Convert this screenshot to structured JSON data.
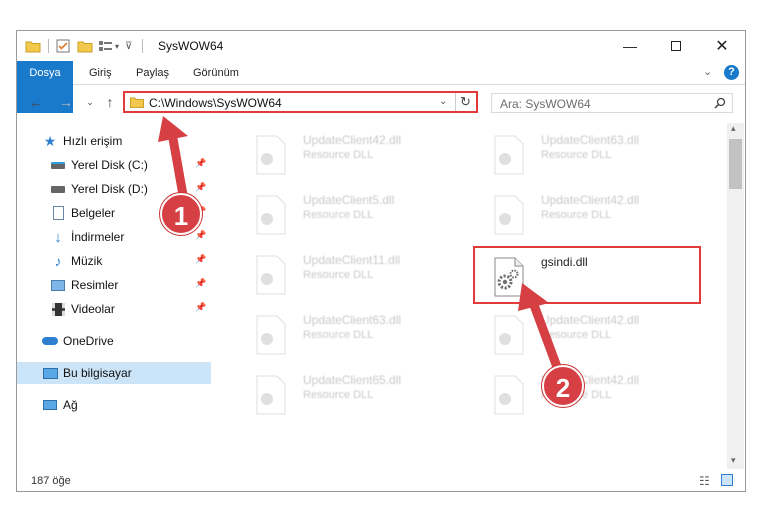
{
  "window": {
    "title": "SysWOW64"
  },
  "ribbon": {
    "tabs": [
      "Dosya",
      "Giriş",
      "Paylaş",
      "Görünüm"
    ]
  },
  "address": {
    "path": "C:\\Windows\\SysWOW64"
  },
  "search": {
    "placeholder": "Ara: SysWOW64"
  },
  "nav": {
    "quick_access": "Hızlı erişim",
    "items": [
      {
        "label": "Yerel Disk (C:)",
        "icon": "drive-icon",
        "pinned": true
      },
      {
        "label": "Yerel Disk (D:)",
        "icon": "drive-icon",
        "pinned": true
      },
      {
        "label": "Belgeler",
        "icon": "documents-icon",
        "pinned": true
      },
      {
        "label": "İndirmeler",
        "icon": "download-icon",
        "pinned": true
      },
      {
        "label": "Müzik",
        "icon": "music-icon",
        "pinned": true
      },
      {
        "label": "Resimler",
        "icon": "pictures-icon",
        "pinned": true
      },
      {
        "label": "Videolar",
        "icon": "video-icon",
        "pinned": true
      }
    ],
    "onedrive": "OneDrive",
    "this_pc": "Bu bilgisayar",
    "network": "Ağ"
  },
  "files": {
    "left": [
      {
        "name": "UpdateClient42.dll",
        "type": "Resource DLL"
      },
      {
        "name": "UpdateClient5.dll",
        "type": "Resource DLL"
      },
      {
        "name": "UpdateClient11.dll",
        "type": "Resource DLL"
      },
      {
        "name": "UpdateClient63.dll",
        "type": "Resource DLL"
      },
      {
        "name": "UpdateClient65.dll",
        "type": "Resource DLL"
      }
    ],
    "right": [
      {
        "name": "UpdateClient63.dll",
        "type": "Resource DLL"
      },
      {
        "name": "UpdateClient42.dll",
        "type": "Resource DLL"
      },
      {
        "name": "gsindi.dll",
        "type": ""
      },
      {
        "name": "UpdateClient42.dll",
        "type": "Resource DLL"
      },
      {
        "name": "UpdateClient42.dll",
        "type": "Resource DLL"
      }
    ]
  },
  "status": {
    "count": "187 öğe"
  },
  "annotations": {
    "step1": "1",
    "step2": "2"
  },
  "colors": {
    "accent": "#1979ca",
    "highlight": "#e03a3a",
    "selected": "#cce4f7"
  }
}
